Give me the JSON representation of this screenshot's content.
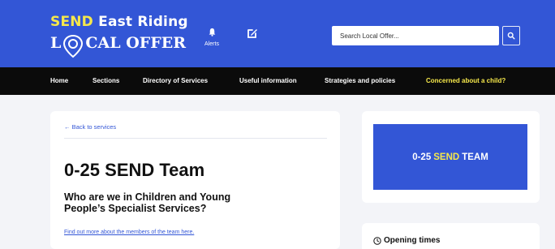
{
  "header": {
    "logo": {
      "send": "SEND",
      "east_riding": "East Riding",
      "local_l": "L",
      "local_rest": "CAL OFFER"
    },
    "alerts_label": "Alerts",
    "search_placeholder": "Search Local Offer..."
  },
  "nav": {
    "items": [
      "Home",
      "Sections",
      "Directory of Services",
      "Useful information",
      "Strategies and policies",
      "Concerned about a child?"
    ]
  },
  "main": {
    "back_link": "← Back to services",
    "title": "0-25 SEND Team",
    "subtitle": "Who are we in Children and Young People’s Specialist Services?",
    "find_link": "Find out more about the members of the team here."
  },
  "sidebar": {
    "banner": {
      "pre": "0-25",
      "send": "SEND",
      "post": "TEAM"
    },
    "opening_times": "Opening times"
  },
  "colors": {
    "brand_blue": "#3356d6",
    "accent_yellow": "#f6e84b",
    "nav_black": "#0b0b0b"
  }
}
